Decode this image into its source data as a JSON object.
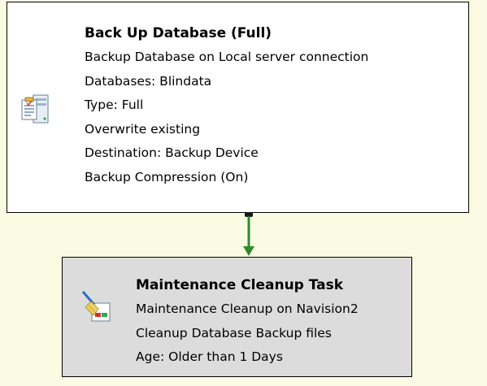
{
  "backup_task": {
    "title": "Back Up Database (Full)",
    "lines": [
      "Backup Database on Local server connection",
      "Databases: Blindata",
      "Type: Full",
      "Overwrite existing",
      "Destination: Backup Device",
      "Backup Compression (On)"
    ],
    "icon": "database-backup-icon"
  },
  "cleanup_task": {
    "title": "Maintenance Cleanup Task",
    "lines": [
      "Maintenance Cleanup on Navision2",
      "Cleanup Database Backup files",
      "Age: Older than 1 Days"
    ],
    "icon": "cleanup-broom-icon"
  },
  "colors": {
    "surface": "#fbfbe3",
    "backup_box_bg": "#ffffff",
    "cleanup_box_bg": "#dcdcdc",
    "success_connector": "#2e8b2e"
  }
}
